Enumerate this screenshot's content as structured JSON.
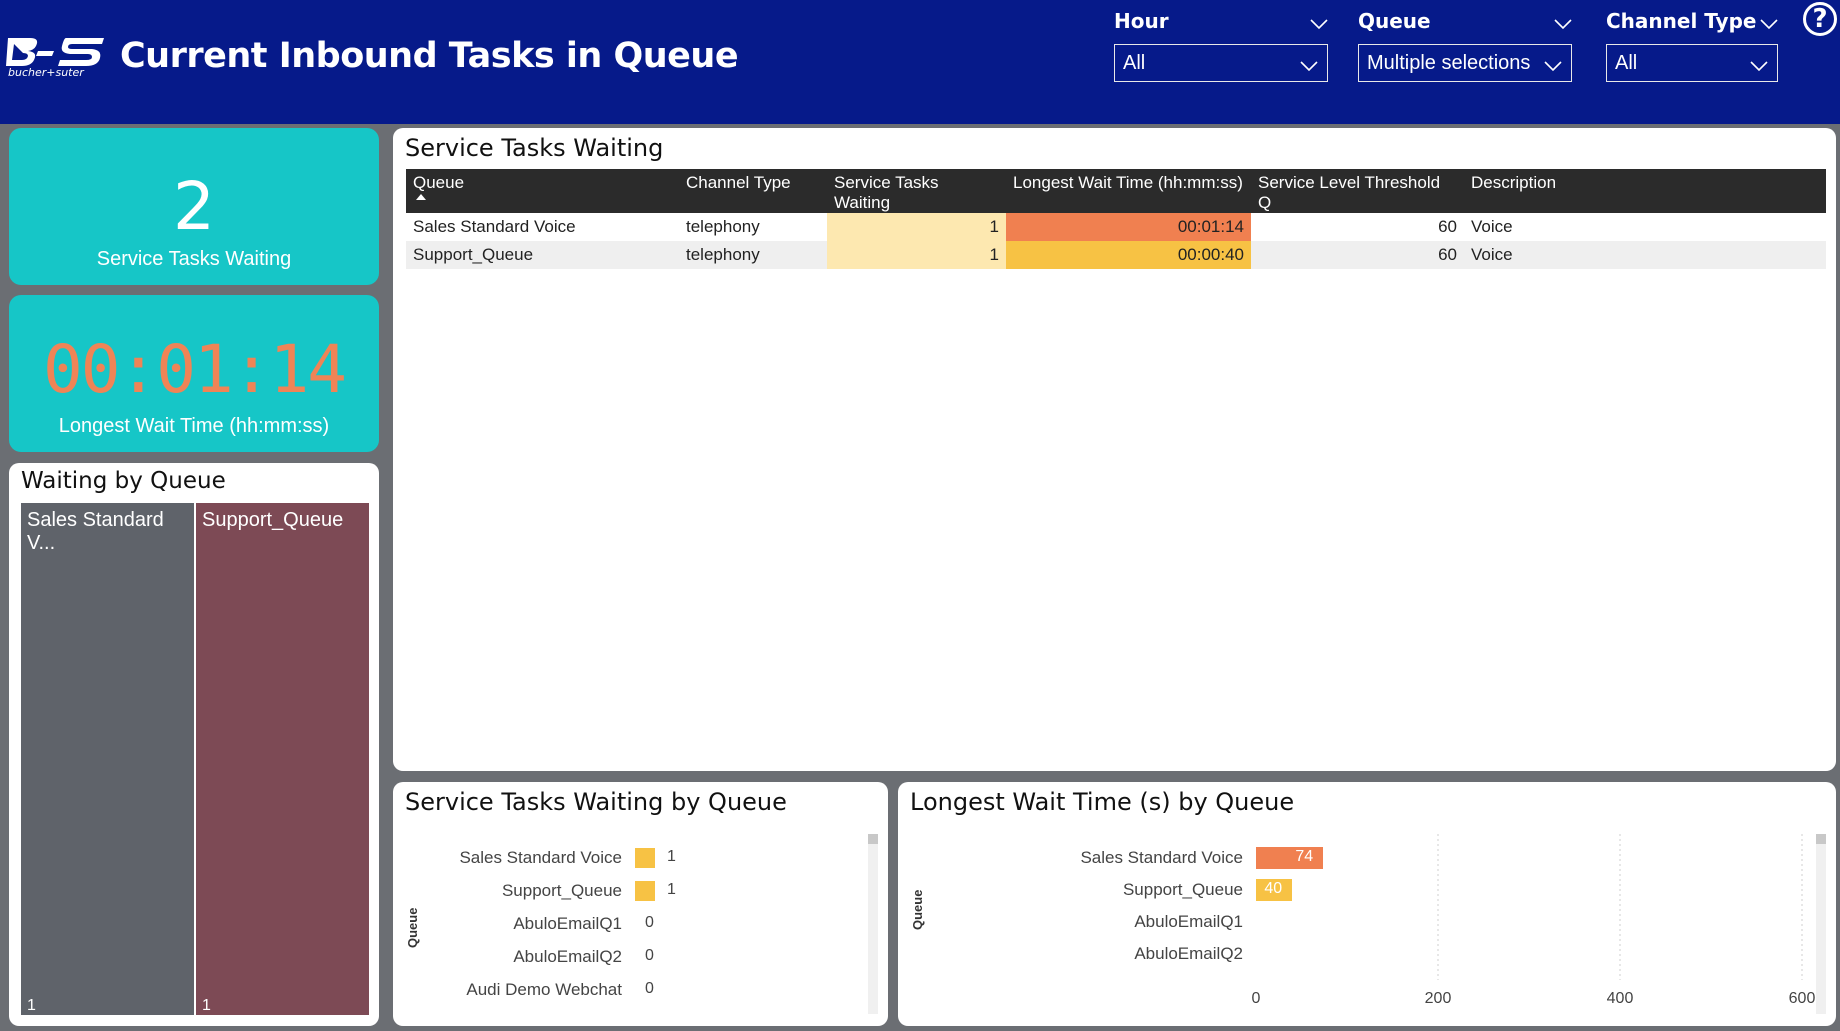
{
  "header": {
    "title": "Current Inbound Tasks in Queue",
    "logo_text": "bucher+suter",
    "slicers": [
      {
        "label": "Hour",
        "value": "All"
      },
      {
        "label": "Queue",
        "value": "Multiple selections"
      },
      {
        "label": "Channel Type",
        "value": "All"
      }
    ],
    "help": "?"
  },
  "kpis": {
    "tasks_waiting": {
      "value": "2",
      "label": "Service Tasks Waiting"
    },
    "longest_wait": {
      "value": "00:01:14",
      "label": "Longest Wait Time (hh:mm:ss)"
    }
  },
  "colors": {
    "header_bg": "#061a8a",
    "kpi_bg": "#16c6c7",
    "wait_orange": "#f08050",
    "wait_amber": "#f7c244",
    "tasks_light": "#fde8b0",
    "treemap_gray": "#5f636a",
    "treemap_maroon": "#7d4a55"
  },
  "waiting_by_queue": {
    "title": "Waiting by Queue",
    "cells": [
      {
        "label": "Sales Standard V...",
        "value": "1"
      },
      {
        "label": "Support_Queue",
        "value": "1"
      }
    ]
  },
  "table": {
    "title": "Service Tasks Waiting",
    "columns": [
      "Queue",
      "Channel Type",
      "Service Tasks Waiting",
      "Longest Wait Time (hh:mm:ss)",
      "Service Level Threshold Q",
      "Description"
    ],
    "rows": [
      [
        "Sales Standard Voice",
        "telephony",
        "1",
        "00:01:14",
        "60",
        "Voice"
      ],
      [
        "Support_Queue",
        "telephony",
        "1",
        "00:00:40",
        "60",
        "Voice"
      ]
    ]
  },
  "chart_data": [
    {
      "type": "bar",
      "title": "Service Tasks Waiting by Queue",
      "ylabel": "Queue",
      "categories": [
        "Sales Standard Voice",
        "Support_Queue",
        "AbuloEmailQ1",
        "AbuloEmailQ2",
        "Audi Demo Webchat"
      ],
      "values": [
        1,
        1,
        0,
        0,
        0
      ],
      "orientation": "horizontal"
    },
    {
      "type": "bar",
      "title": "Longest Wait Time (s) by Queue",
      "ylabel": "Queue",
      "categories": [
        "Sales Standard Voice",
        "Support_Queue",
        "AbuloEmailQ1",
        "AbuloEmailQ2"
      ],
      "values": [
        74,
        40,
        null,
        null
      ],
      "xlim": [
        0,
        600
      ],
      "xticks": [
        0,
        200,
        400,
        600
      ],
      "grid": true,
      "orientation": "horizontal"
    }
  ]
}
